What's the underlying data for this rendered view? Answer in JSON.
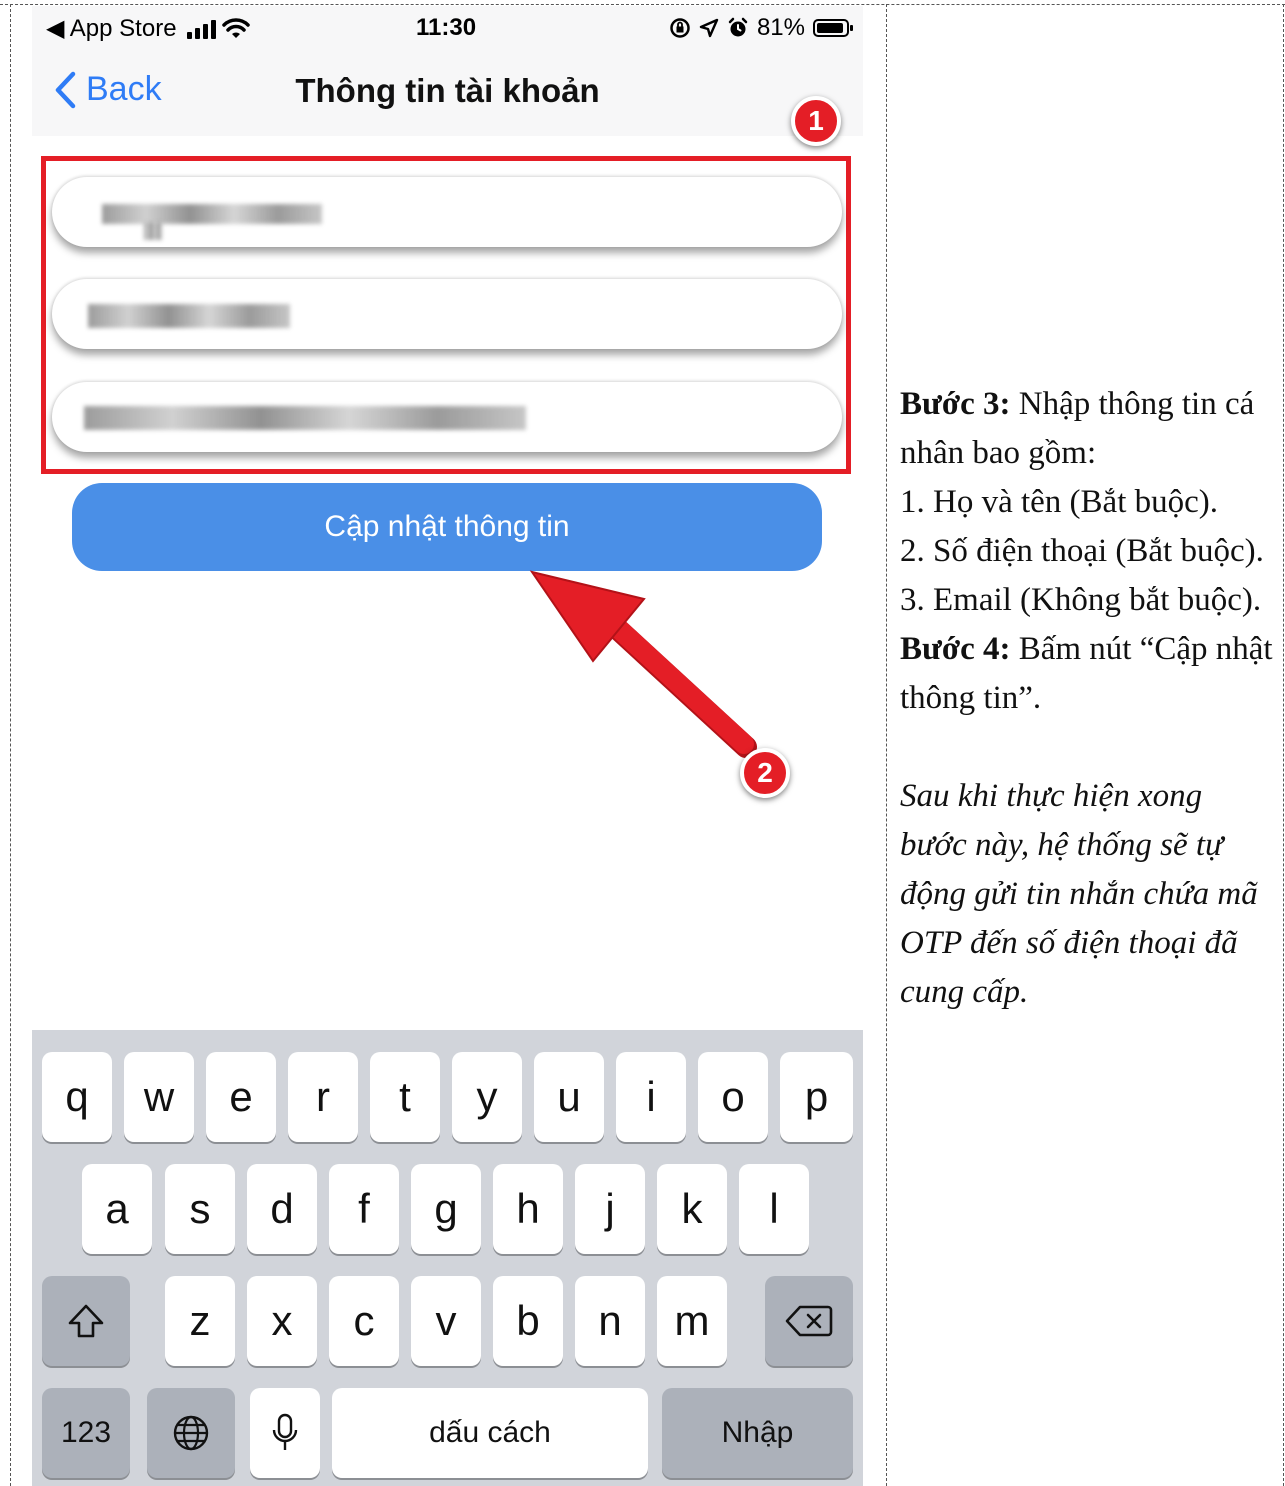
{
  "status_bar": {
    "back_app": "◀ App Store",
    "time": "11:30",
    "battery_percent": "81%"
  },
  "nav": {
    "back_label": "Back",
    "title": "Thông tin tài khoản"
  },
  "form": {
    "update_button_label": "Cập nhật thông tin"
  },
  "badges": {
    "one": "1",
    "two": "2"
  },
  "keyboard": {
    "row1": [
      "q",
      "w",
      "e",
      "r",
      "t",
      "y",
      "u",
      "i",
      "o",
      "p"
    ],
    "row2": [
      "a",
      "s",
      "d",
      "f",
      "g",
      "h",
      "j",
      "k",
      "l"
    ],
    "row3": [
      "z",
      "x",
      "c",
      "v",
      "b",
      "n",
      "m"
    ],
    "numbers_label": "123",
    "space_label": "dấu cách",
    "return_label": "Nhập"
  },
  "instructions": {
    "step3_label": "Bước 3:",
    "step3_text": " Nhập thông tin cá nhân bao gồm:",
    "item1": "1. Họ và tên (Bắt buộc).",
    "item2": "2. Số điện thoại (Bắt buộc).",
    "item3": "3. Email (Không bắt buộc).",
    "step4_label": "Bước 4:",
    "step4_text": " Bấm nút “Cập nhật thông tin”.",
    "note": "Sau khi thực hiện xong bước này, hệ thống sẽ tự động gửi tin nhắn chứa mã OTP đến số điện thoại đã cung cấp."
  }
}
